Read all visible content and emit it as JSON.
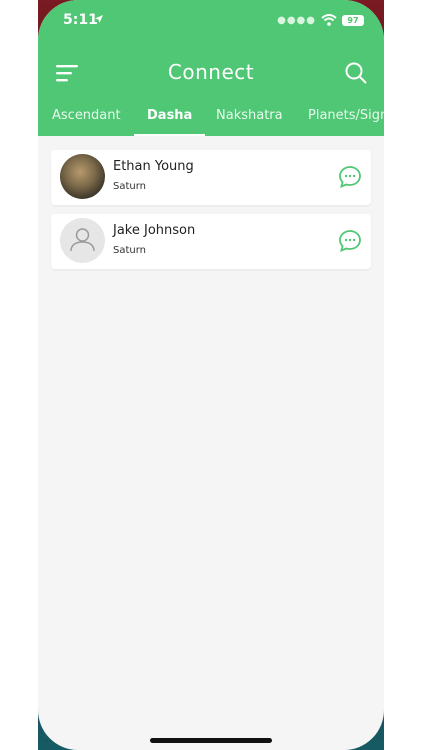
{
  "status_bar": {
    "time": "5:11",
    "battery": "97"
  },
  "header": {
    "title": "Connect",
    "tabs": [
      {
        "label": "Ascendant"
      },
      {
        "label": "Dasha"
      },
      {
        "label": "Nakshatra"
      },
      {
        "label": "Planets/Sign"
      }
    ],
    "active_tab": "Dasha",
    "color": "#4fc774"
  },
  "contacts": [
    {
      "name": "Ethan Young",
      "detail": "Saturn",
      "avatar": "photo"
    },
    {
      "name": "Jake Johnson",
      "detail": "Saturn",
      "avatar": "placeholder-person"
    }
  ]
}
